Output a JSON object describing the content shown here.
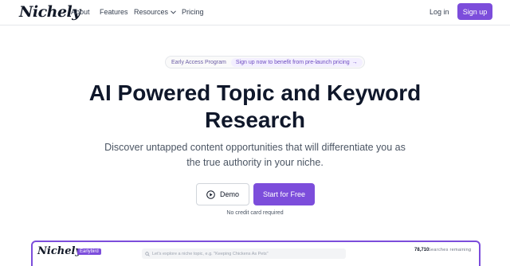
{
  "nav": {
    "logo": "Nichely",
    "links": [
      "About",
      "Features",
      "Resources",
      "Pricing"
    ],
    "login": "Log in",
    "signup": "Sign up"
  },
  "announcement": {
    "tag": "Early Access Program",
    "cta": "Sign up now to benefit from pre-launch pricing",
    "arrow": "→"
  },
  "hero": {
    "title_line1": "AI Powered Topic and Keyword",
    "title_line2": "Research",
    "subtitle_line1": "Discover untapped content opportunities that will differentiate you as",
    "subtitle_line2": "the true authority in your niche."
  },
  "buttons": {
    "demo": "Demo",
    "start": "Start for Free",
    "note": "No credit card required"
  },
  "preview": {
    "logo": "Nichely",
    "badge": "Earlybird",
    "search_placeholder": "Let's explore a niche topic, e.g. \"Keeping Chickens As Pets\"",
    "count": "78,710",
    "count_label": "Searches remaining"
  },
  "colors": {
    "accent": "#7c4ddb",
    "text_dark": "#0f172a",
    "text_muted": "#4b5563"
  }
}
